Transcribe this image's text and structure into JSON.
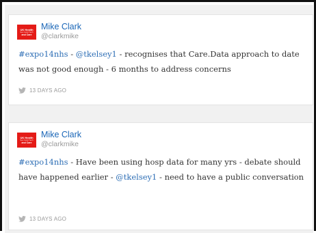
{
  "tweets": [
    {
      "avatar": {
        "line1": "UK Health",
        "line2": "Sec Gold Tech",
        "line3": "and Care"
      },
      "name": "Mike Clark",
      "handle": "@clarkmike",
      "parts": [
        "#expo14nhs",
        " - ",
        "@tkelsey1",
        " - recognises that Care.Data approach to date was not good enough - 6 months to address concerns"
      ],
      "time": "13 DAYS AGO"
    },
    {
      "avatar": {
        "line1": "UK Health",
        "line2": "Sec Gold Tech",
        "line3": "and Care"
      },
      "name": "Mike Clark",
      "handle": "@clarkmike",
      "parts": [
        "#expo14nhs",
        " - Have been using hosp data for many yrs - debate should have happened earlier - ",
        "@tkelsey1",
        " - need to have a public conversation"
      ],
      "time": "13 DAYS AGO"
    }
  ],
  "colors": {
    "link": "#2d6eb5",
    "name": "#1a66b7",
    "avatar_bg": "#e41b17",
    "meta": "#999999"
  },
  "icons": {
    "meta": "twitter-bird-icon"
  }
}
